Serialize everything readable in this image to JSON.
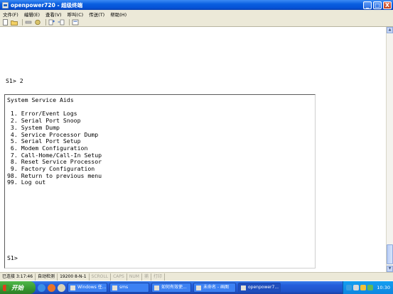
{
  "window": {
    "title": "openpower720 - 超级终端",
    "controls": {
      "minimize": "_",
      "maximize": "□",
      "close": "X"
    }
  },
  "menu": [
    "文件(F)",
    "编辑(E)",
    "查看(V)",
    "呼叫(C)",
    "传送(T)",
    "帮助(H)"
  ],
  "toolbar": {
    "icons": [
      "new-connection-icon",
      "open-icon",
      "disconnect-icon",
      "connect-icon",
      "send-file-icon",
      "receive-file-icon",
      "properties-icon"
    ]
  },
  "terminal": {
    "top_prompt": "S1> 2",
    "panel_title": "System Service Aids",
    "items": [
      " 1. Error/Event Logs",
      " 2. Serial Port Snoop",
      " 3. System Dump",
      " 4. Service Processor Dump",
      " 5. Serial Port Setup",
      " 6. Modem Configuration",
      " 7. Call-Home/Call-In Setup",
      " 8. Reset Service Processor",
      " 9. Factory Configuration",
      "98. Return to previous menu",
      "99. Log out"
    ],
    "bottom_prompt": "S1>"
  },
  "status": {
    "connection": "已连接 3:17:46",
    "detect": "自动检测",
    "baud": "19200 8-N-1",
    "scroll": "SCROLL",
    "caps": "CAPS",
    "num": "NUM",
    "capture": "捕",
    "print": "打印"
  },
  "taskbar": {
    "start_label": "开始",
    "tasks": [
      "Windows 任...",
      "sms",
      "如何有效使...",
      "未命名 - 画图",
      "openpower7..."
    ],
    "active_task_index": 4,
    "clock": "10:30"
  }
}
